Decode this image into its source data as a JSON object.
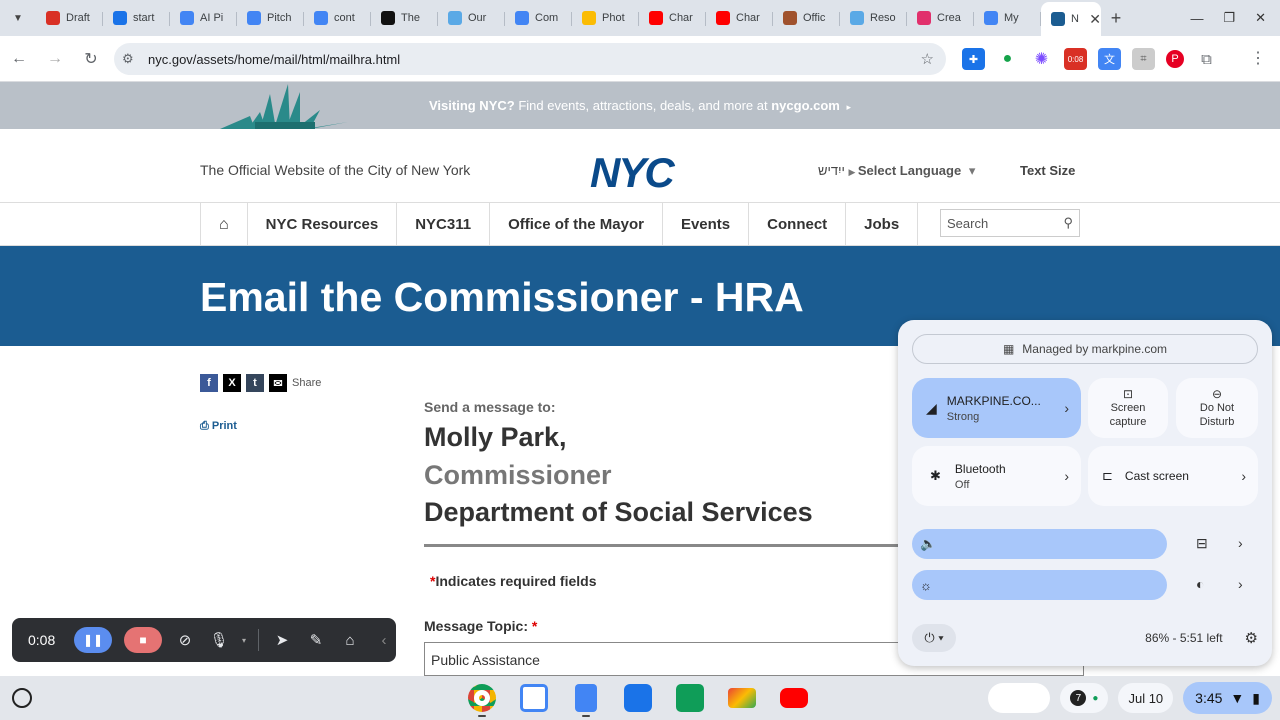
{
  "tabs": [
    {
      "title": "Draft",
      "color": "#d93025"
    },
    {
      "title": "start",
      "color": "#1a73e8"
    },
    {
      "title": "AI Pi",
      "color": "#4285f4"
    },
    {
      "title": "Pitch",
      "color": "#4285f4"
    },
    {
      "title": "cont",
      "color": "#4285f4"
    },
    {
      "title": "The",
      "color": "#111111"
    },
    {
      "title": "Our",
      "color": "#5aa9e6"
    },
    {
      "title": "Com",
      "color": "#4285f4"
    },
    {
      "title": "Phot",
      "color": "#fbbc04"
    },
    {
      "title": "Char",
      "color": "#ff0000"
    },
    {
      "title": "Char",
      "color": "#ff0000"
    },
    {
      "title": "Offic",
      "color": "#a0522d"
    },
    {
      "title": "Reso",
      "color": "#5aa9e6"
    },
    {
      "title": "Crea",
      "color": "#e1306c"
    },
    {
      "title": "My",
      "color": "#4285f4"
    }
  ],
  "active_tab": {
    "title": "NYC"
  },
  "address": {
    "url": "nyc.gov/assets/home/mail/html/mailhra.html"
  },
  "extension_badge": "0:08",
  "promo": {
    "bold1": "Visiting NYC?",
    "text": " Find events, attractions, deals, and more at ",
    "bold2": "nycgo.com",
    "arrow": "▸"
  },
  "header": {
    "official": "The Official Website of the City of New York",
    "logo": "NYC",
    "lang_native": "ייִדיש",
    "lang_select": "Select Language",
    "text_size": "Text Size"
  },
  "nav": {
    "items": [
      "NYC Resources",
      "NYC311",
      "Office of the Mayor",
      "Events",
      "Connect",
      "Jobs"
    ],
    "search_placeholder": "Search"
  },
  "banner": {
    "title": "Email the Commissioner - HRA"
  },
  "share": {
    "label": "Share",
    "print": "Print"
  },
  "recipient": {
    "send_to": "Send a message to:",
    "name": "Molly Park,",
    "role": "Commissioner",
    "dept": "Department of Social Services"
  },
  "form": {
    "required_note": "Indicates required fields",
    "topic_label": "Message Topic:",
    "topic_value": "Public Assistance"
  },
  "recorder": {
    "time": "0:08"
  },
  "quick_settings": {
    "managed": "Managed by markpine.com",
    "wifi_name": "MARKPINE.CO...",
    "wifi_status": "Strong",
    "screen_capture": "Screen capture",
    "dnd": "Do Not Disturb",
    "bluetooth": "Bluetooth",
    "bluetooth_status": "Off",
    "cast": "Cast screen",
    "battery": "86% - 5:51 left"
  },
  "shelf": {
    "notifications": "7",
    "date": "Jul 10",
    "time": "3:45"
  }
}
